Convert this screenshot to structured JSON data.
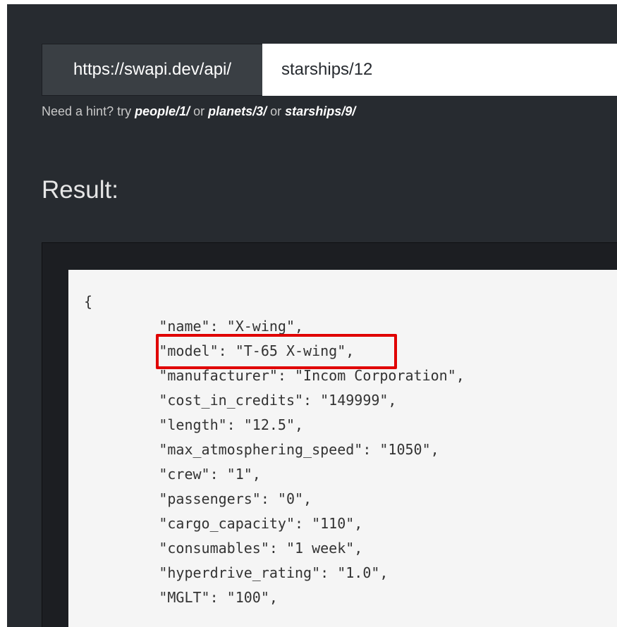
{
  "url_bar": {
    "prefix": "https://swapi.dev/api/",
    "path_value": "starships/12"
  },
  "hint": {
    "lead": "Need a hint? try ",
    "link1": "people/1/",
    "sep1": " or ",
    "link2": "planets/3/",
    "sep2": " or ",
    "link3": "starships/9/"
  },
  "result": {
    "title": "Result:",
    "lines": [
      "{",
      "        \"name\": \"X-wing\",",
      "        \"model\": \"T-65 X-wing\",",
      "        \"manufacturer\": \"Incom Corporation\",",
      "        \"cost_in_credits\": \"149999\",",
      "        \"length\": \"12.5\",",
      "        \"max_atmosphering_speed\": \"1050\",",
      "        \"crew\": \"1\",",
      "        \"passengers\": \"0\",",
      "        \"cargo_capacity\": \"110\",",
      "        \"consumables\": \"1 week\",",
      "        \"hyperdrive_rating\": \"1.0\",",
      "        \"MGLT\": \"100\","
    ]
  },
  "colors": {
    "page_bg": "#272b30",
    "highlight": "#e00000"
  }
}
